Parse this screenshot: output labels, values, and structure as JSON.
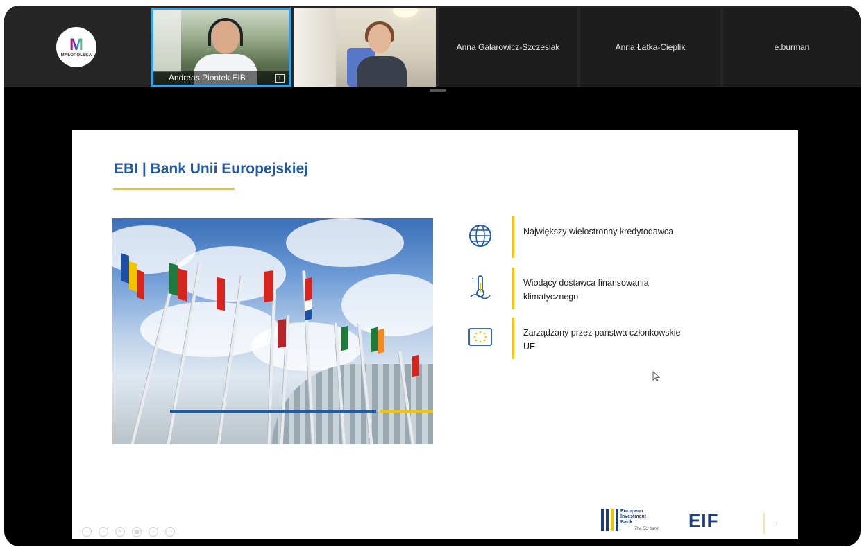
{
  "app": {
    "logo_text": "MAŁOPOLSKA"
  },
  "participants": [
    {
      "name": "Andreas Piontek EIB",
      "video": true,
      "active_speaker": true
    },
    {
      "name": "",
      "video": true,
      "active_speaker": false
    },
    {
      "name": "Anna Galarowicz-Szczesiak",
      "video": false
    },
    {
      "name": "Anna Łatka-Cieplik",
      "video": false
    },
    {
      "name": "e.burman",
      "video": false
    }
  ],
  "slide": {
    "title": "EBI | Bank Unii Europejskiej",
    "features": [
      {
        "icon": "globe-icon",
        "text": "Największy wielostronny kredytodawca"
      },
      {
        "icon": "thermometer-icon",
        "text": "Wiodący dostawca finansowania klimatycznego"
      },
      {
        "icon": "eu-stars-icon",
        "text": "Zarządzany przez państwa członkowskie UE"
      }
    ],
    "eib_logo_lines": [
      "European",
      "Investment",
      "Bank"
    ],
    "eib_tagline": "The EU bank",
    "eif_logo": "EIF"
  },
  "colors": {
    "accent_blue": "#1f5aa6",
    "accent_yellow": "#f5c400",
    "active_speaker_border": "#2ea3ec"
  }
}
